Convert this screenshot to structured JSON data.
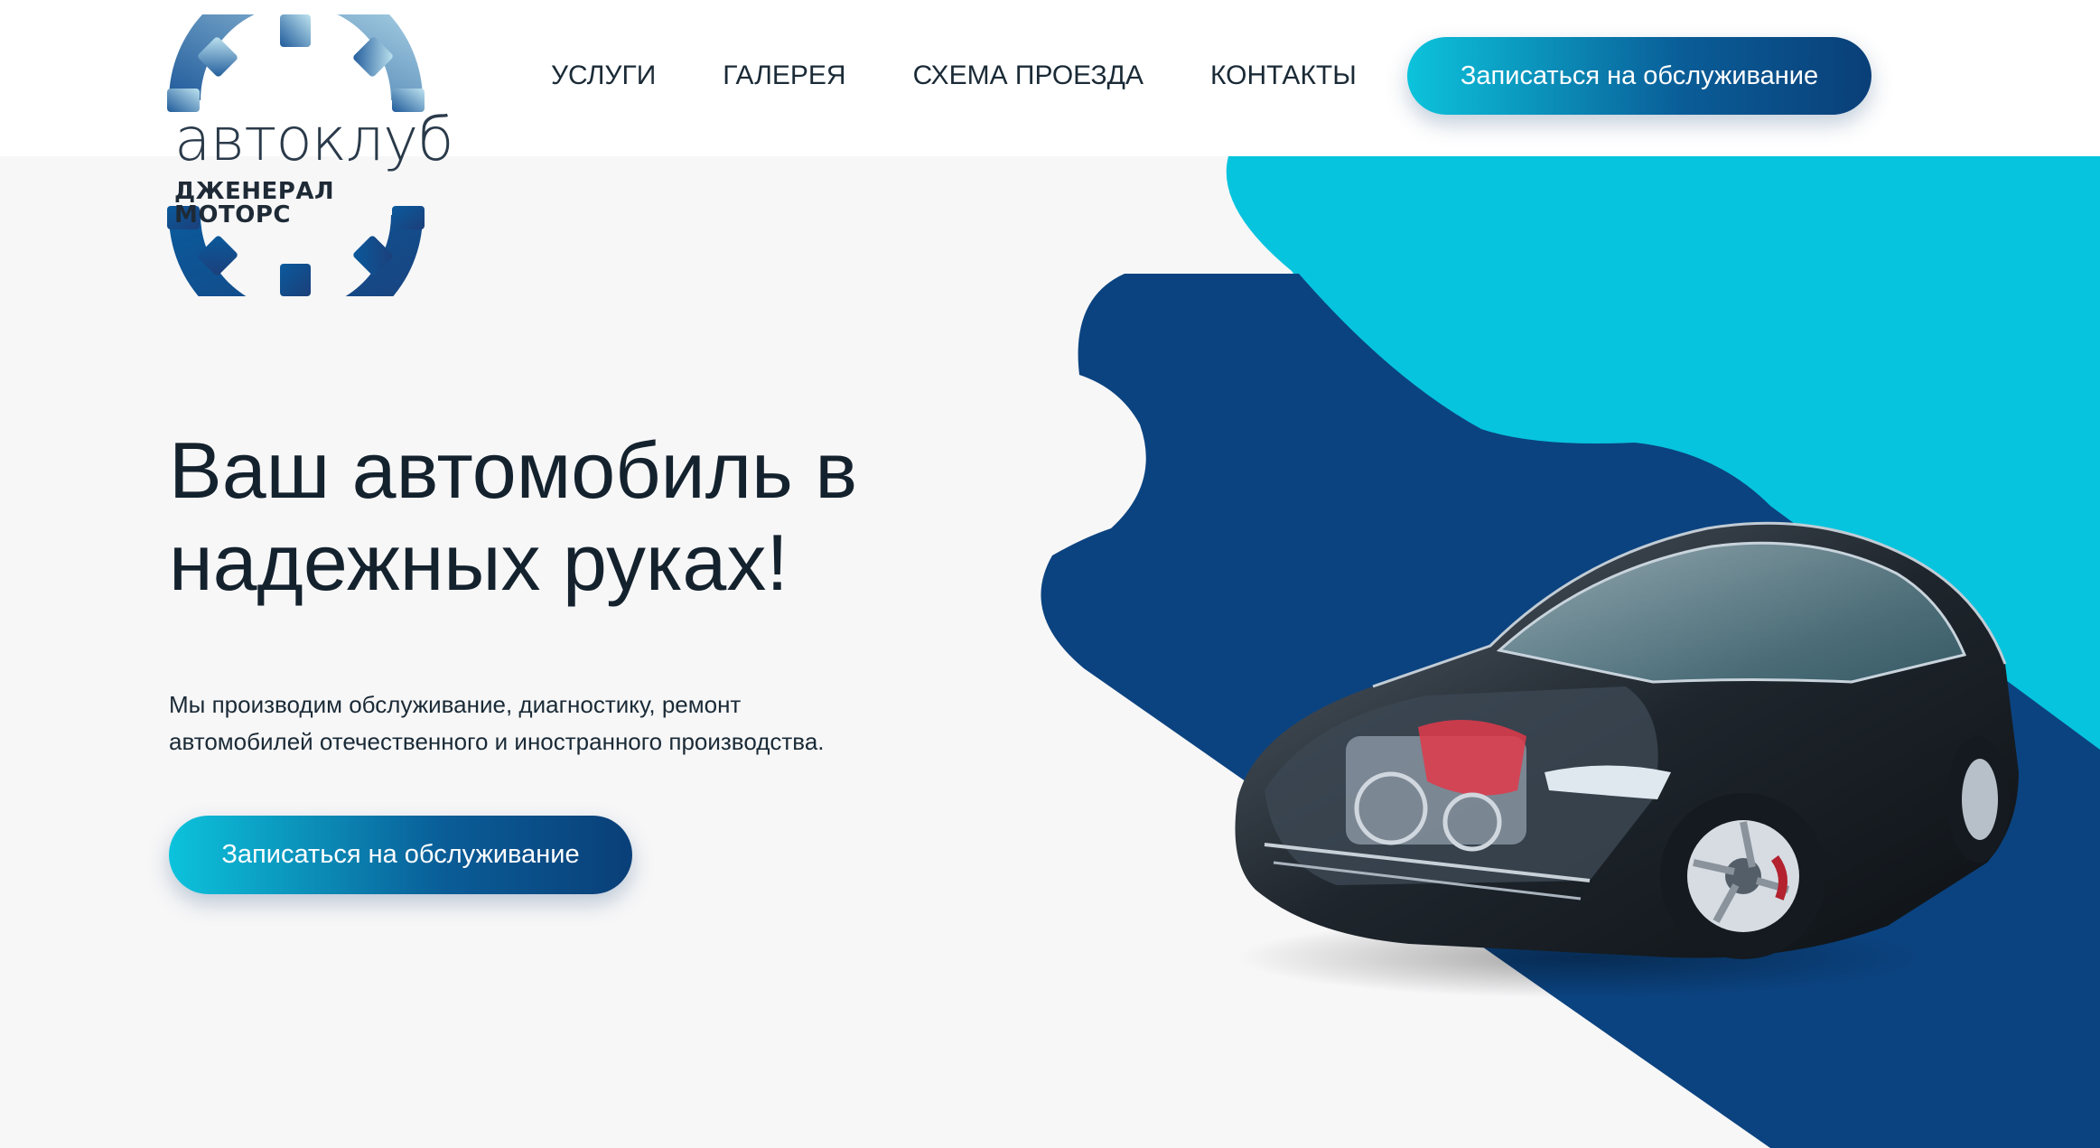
{
  "logo": {
    "wordmark": "автоклуб",
    "subtitle": "ДЖЕНЕРАЛ МОТОРС",
    "icon": "gear-icon"
  },
  "nav": {
    "items": [
      {
        "label": "УСЛУГИ"
      },
      {
        "label": "ГАЛЕРЕЯ"
      },
      {
        "label": "СХЕМА ПРОЕЗДА"
      },
      {
        "label": "КОНТАКТЫ"
      }
    ]
  },
  "header": {
    "cta_label": "Записаться на обслуживание"
  },
  "hero": {
    "title_line1": "Ваш автомобиль в",
    "title_line2": "надежных руках!",
    "text_line1": "Мы производим обслуживание, диагностику, ремонт",
    "text_line2": "автомобилей отечественного и иностранного производства.",
    "cta_label": "Записаться на обслуживание",
    "image": "car-xray-image"
  },
  "colors": {
    "cyan": "#07c4de",
    "navy": "#0b4380",
    "text": "#14222e",
    "background": "#f7f7f8"
  }
}
